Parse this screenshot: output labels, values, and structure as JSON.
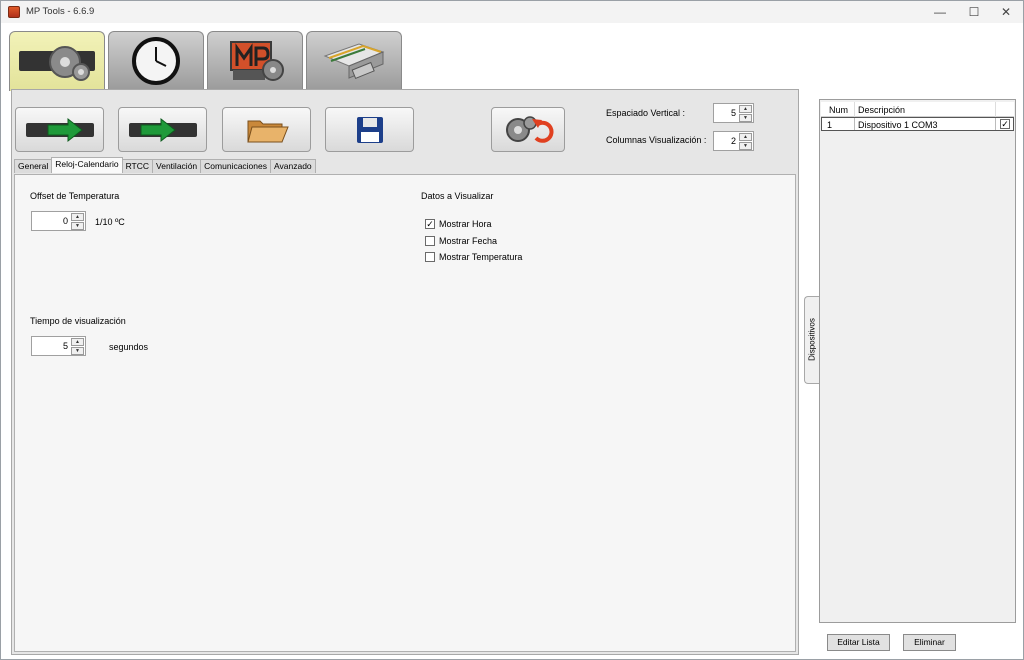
{
  "window": {
    "title": "MP Tools - 6.6.9",
    "controls": {
      "minimize": "—",
      "maximize": "☐",
      "close": "✕"
    }
  },
  "main_tabs": [
    {
      "icon": "settings-gears-icon",
      "active": true
    },
    {
      "icon": "clock-icon",
      "active": false
    },
    {
      "icon": "mp-tools-logo-icon",
      "active": false
    },
    {
      "icon": "serial-connector-icon",
      "active": false
    }
  ],
  "toolbar": {
    "buttons": [
      {
        "icon": "download-arrow-icon"
      },
      {
        "icon": "upload-arrow-icon"
      },
      {
        "icon": "open-folder-icon"
      },
      {
        "icon": "save-disk-icon"
      },
      {
        "icon": "reset-settings-icon"
      }
    ],
    "espaciado_label": "Espaciado Vertical :",
    "espaciado_value": "5",
    "columnas_label": "Columnas Visualización :",
    "columnas_value": "2"
  },
  "sub_tabs": [
    "General",
    "Reloj-Calendario",
    "RTCC",
    "Ventilación",
    "Comunicaciones",
    "Avanzado"
  ],
  "selected_sub_tab": "Reloj-Calendario",
  "offset": {
    "label": "Offset de Temperatura",
    "value": "0",
    "unit": "1/10 ºC"
  },
  "tiempo": {
    "label": "Tiempo de visualización",
    "value": "5",
    "unit": "segundos"
  },
  "datos": {
    "label": "Datos a Visualizar",
    "options": [
      {
        "label": "Mostrar Hora",
        "checked": true
      },
      {
        "label": "Mostrar Fecha",
        "checked": false
      },
      {
        "label": "Mostrar Temperatura",
        "checked": false
      }
    ]
  },
  "side_tab": {
    "label": "Dispositivos"
  },
  "device_table": {
    "columns": [
      "Num",
      "Descripción"
    ],
    "rows": [
      {
        "num": "1",
        "descripcion": "Dispositivo 1 COM3",
        "checked": true
      }
    ]
  },
  "buttons": {
    "edit": "Editar Lista",
    "delete": "Eliminar"
  },
  "colors": {
    "active_tab": "#e8e8a6",
    "arrow_green": "#1f9a3a",
    "reset_red": "#e04020"
  }
}
